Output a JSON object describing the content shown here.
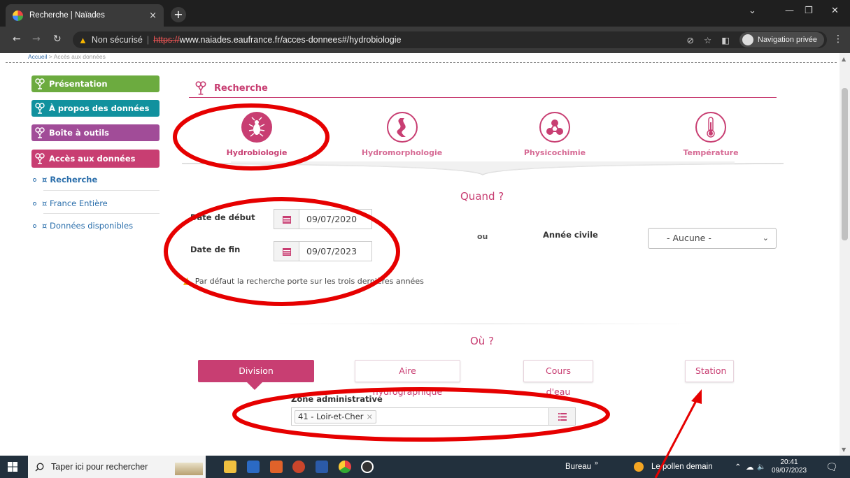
{
  "browser": {
    "tab_title": "Recherche | Naïades",
    "tab_close": "×",
    "new_tab": "+",
    "security_label": "Non sécurisé",
    "url_scheme": "https://",
    "url_rest": "www.naiades.eaufrance.fr/acces-donnees#/hydrobiologie",
    "private_label": "Navigation privée"
  },
  "breadcrumb": {
    "home": "Accueil",
    "separator": ">",
    "current": "Accès aux données"
  },
  "sidebar": {
    "items": [
      {
        "label": "Présentation",
        "color": "#6cab3f"
      },
      {
        "label": "À propos des données",
        "color": "#11919e"
      },
      {
        "label": "Boîte à outils",
        "color": "#a14c98"
      },
      {
        "label": "Accès aux données",
        "color": "#c83e72"
      }
    ],
    "subnav": [
      {
        "label": "¤ Recherche",
        "active": true
      },
      {
        "label": "¤ France Entière",
        "active": false
      },
      {
        "label": "¤ Données disponibles",
        "active": false
      }
    ]
  },
  "search": {
    "title": "Recherche",
    "categories": [
      {
        "label": "Hydrobiologie",
        "icon": "insect-icon",
        "active": true
      },
      {
        "label": "Hydromorphologie",
        "icon": "river-icon",
        "active": false
      },
      {
        "label": "Physicochimie",
        "icon": "molecule-icon",
        "active": false
      },
      {
        "label": "Température",
        "icon": "thermometer-icon",
        "active": false
      }
    ]
  },
  "quand": {
    "title": "Quand ?",
    "start_label": "Date de début",
    "start_value": "09/07/2020",
    "end_label": "Date de fin",
    "end_value": "09/07/2023",
    "or_label": "ou",
    "year_label": "Année civile",
    "year_value": "- Aucune -",
    "hint": "Par défaut la recherche porte sur les trois dernières années"
  },
  "ou": {
    "title": "Où ?",
    "tabs": [
      {
        "label": "Division administrative",
        "active": true
      },
      {
        "label": "Aire hydrographique",
        "active": false
      },
      {
        "label": "Cours d'eau",
        "active": false
      },
      {
        "label": "Station",
        "active": false
      }
    ],
    "zone_label": "Zone administrative",
    "zone_chip": "41 - Loir-et-Cher",
    "zone_chip_remove": "×"
  },
  "taskbar": {
    "search_placeholder": "Taper ici pour rechercher",
    "bureau": "Bureau",
    "weather": "Le pollen demain",
    "time": "20:41",
    "date": "09/07/2023"
  },
  "colors": {
    "accent": "#c83e72",
    "annotation": "#e60000"
  }
}
